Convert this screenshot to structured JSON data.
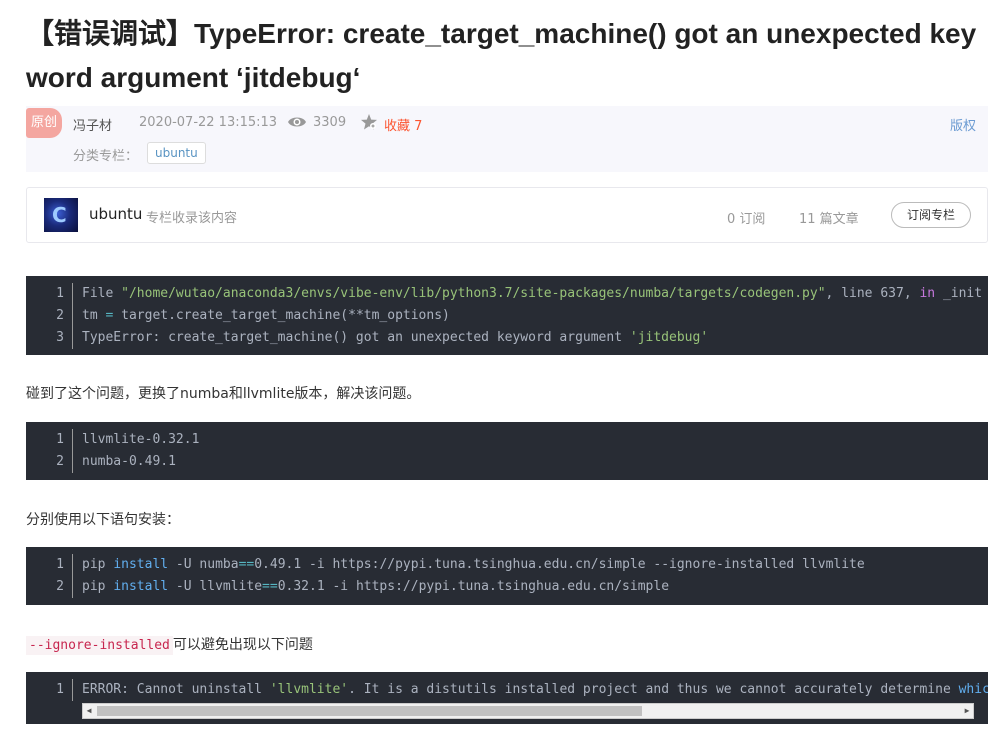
{
  "article": {
    "title": "【错误调试】TypeError: create_target_machine() got an unexpected keyword argument ‘jitdebug‘"
  },
  "meta": {
    "original_badge": "原创",
    "author": "冯子材",
    "date": "2020-07-22 13:15:13",
    "views": "3309",
    "favorites": "收藏 7",
    "copyright": "版权",
    "category_label": "分类专栏：",
    "category_tag": "ubuntu"
  },
  "column": {
    "name": "ubuntu",
    "description": "专栏收录该内容",
    "subscribers": "0 订阅",
    "articles": "11 篇文章",
    "subscribe_button": "订阅专栏"
  },
  "code_block_1": {
    "line_numbers": [
      "1",
      "2",
      "3"
    ],
    "line1_prefix": "File ",
    "line1_string": "\"/home/wutao/anaconda3/envs/vibe-env/lib/python3.7/site-packages/numba/targets/codegen.py\"",
    "line1_mid": ", line 637, ",
    "line1_keyword": "in",
    "line1_suffix": " _init",
    "line2_a": "tm ",
    "line2_op": "=",
    "line2_b": " target.create_target_machine(**tm_options)",
    "line3_a": "TypeError: create_target_machine() got an unexpected keyword argument ",
    "line3_string": "'jitdebug'"
  },
  "paragraph_1": "碰到了这个问题，更换了numba和llvmlite版本，解决该问题。",
  "code_block_2": {
    "line_numbers": [
      "1",
      "2"
    ],
    "lines": [
      "llvmlite-0.32.1",
      "numba-0.49.1"
    ]
  },
  "paragraph_2": "分别使用以下语句安装：",
  "code_block_3": {
    "line_numbers": [
      "1",
      "2"
    ],
    "line1_a": "pip ",
    "line1_builtin": "install",
    "line1_b": " -U numba",
    "line1_op": "==",
    "line1_c": "0.49.1 -i https://pypi.tuna.tsinghua.edu.cn/simple --ignore-installed llvmlite",
    "line2_a": "pip ",
    "line2_builtin": "install",
    "line2_b": " -U llvmlite",
    "line2_op": "==",
    "line2_c": "0.32.1 -i https://pypi.tuna.tsinghua.edu.cn/simple"
  },
  "paragraph_3": {
    "code": "--ignore-installed",
    "text": "可以避免出现以下问题"
  },
  "code_block_4": {
    "line_numbers": [
      "1"
    ],
    "line1_a": "ERROR: Cannot uninstall ",
    "line1_string": "'llvmlite'",
    "line1_b": ". It is a distutils installed project and thus we cannot accurately determine ",
    "line1_keyword": "whic"
  },
  "icons": {
    "views": "eye-icon",
    "favorites": "star-icon",
    "column_cover": "column-cover-image"
  },
  "colors": {
    "accent_red": "#fc5531",
    "code_bg": "#282c34",
    "string_green": "#98c379",
    "keyword_purple": "#c678dd",
    "builtin_blue": "#61aeee"
  }
}
